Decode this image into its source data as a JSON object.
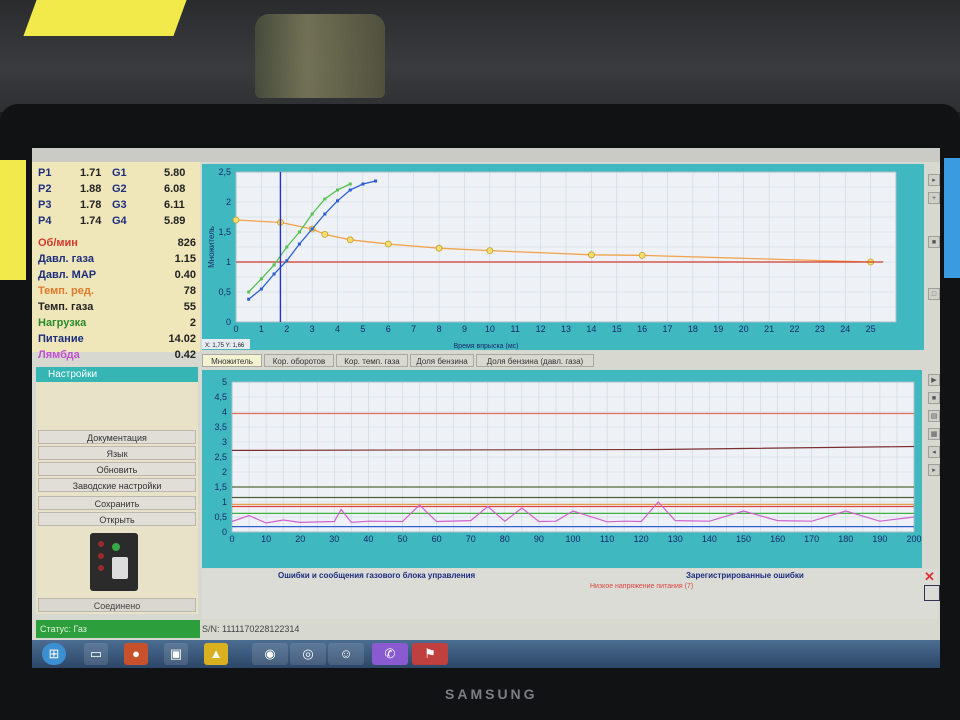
{
  "readouts": {
    "injectors": [
      {
        "p": "P1",
        "pv": "1.71",
        "g": "G1",
        "gv": "5.80"
      },
      {
        "p": "P2",
        "pv": "1.88",
        "g": "G2",
        "gv": "6.08"
      },
      {
        "p": "P3",
        "pv": "1.78",
        "g": "G3",
        "gv": "6.11"
      },
      {
        "p": "P4",
        "pv": "1.74",
        "g": "G4",
        "gv": "5.89"
      }
    ],
    "params": [
      {
        "label": "Об/мин",
        "value": "826",
        "color": "#d33a2c"
      },
      {
        "label": "Давл. газа",
        "value": "1.15",
        "color": "#1d2e7e"
      },
      {
        "label": "Давл. MAP",
        "value": "0.40",
        "color": "#1d2e7e"
      },
      {
        "label": "Темп. ред.",
        "value": "78",
        "color": "#e07a2a"
      },
      {
        "label": "Темп. газа",
        "value": "55",
        "color": "#222222"
      },
      {
        "label": "Нагрузка",
        "value": "2",
        "color": "#2b8a2b"
      },
      {
        "label": "Питание",
        "value": "14.02",
        "color": "#1d2e7e"
      },
      {
        "label": "Лямбда",
        "value": "0.42",
        "color": "#c24fd0"
      }
    ]
  },
  "settings": {
    "header": "Настройки",
    "buttons": [
      {
        "name": "documentation-button",
        "label": "Документация"
      },
      {
        "name": "language-select",
        "label": "Язык"
      },
      {
        "name": "update-button",
        "label": "Обновить"
      },
      {
        "name": "factory-settings-button",
        "label": "Заводские настройки"
      },
      {
        "name": "save-button",
        "label": "Сохранить"
      },
      {
        "name": "open-button",
        "label": "Открыть"
      }
    ],
    "connection": "Соединено"
  },
  "status": {
    "text": "Статус: Газ",
    "serial": "S/N: 1111170228122314"
  },
  "tabs": [
    "Множитель",
    "Кор. оборотов",
    "Кор. темп. газа",
    "Доля бензина",
    "Доля бензина (давл. газа)"
  ],
  "errors": {
    "title_left": "Ошибки и сообщения газового блока управления",
    "title_right": "Зарегистрированные ошибки",
    "message": "Низкое напряжение питания (7)"
  },
  "colors": {
    "accent": "#3fb8c0",
    "plot_bg": "#eef2f6",
    "status_green": "#2d9e3c"
  },
  "chart_data": [
    {
      "type": "line",
      "xlabel": "Время впрыска (мс)",
      "ylabel": "Множитель",
      "xlim": [
        0,
        26
      ],
      "ylim": [
        0,
        2.5
      ],
      "xticks": [
        "0",
        "1",
        "2",
        "3",
        "4",
        "5",
        "6",
        "7",
        "8",
        "9",
        "10",
        "11",
        "12",
        "13",
        "14",
        "15",
        "16",
        "17",
        "18",
        "19",
        "20",
        "21",
        "22",
        "23",
        "24",
        "25"
      ],
      "yticks": [
        "0",
        "0,5",
        "1",
        "1,5",
        "2",
        "2,5"
      ],
      "cursor_readout": "X: 1,75  Y: 1,66",
      "cursor_x": 1.75,
      "series": [
        {
          "color": "#f2a24a",
          "x": [
            0,
            1.75,
            3,
            3.5,
            4.5,
            6,
            8,
            10,
            14,
            16,
            25
          ],
          "y": [
            1.7,
            1.66,
            1.55,
            1.46,
            1.37,
            1.3,
            1.23,
            1.19,
            1.12,
            1.11,
            1.0
          ]
        },
        {
          "color": "#d23a2c",
          "x": [
            0,
            25.5
          ],
          "y": [
            1.0,
            1.0
          ]
        },
        {
          "color": "#2a5ed0",
          "x": [
            0.5,
            1,
            1.5,
            2,
            2.5,
            3,
            3.5,
            4,
            4.5,
            5,
            5.5
          ],
          "y": [
            0.38,
            0.55,
            0.8,
            1.02,
            1.3,
            1.55,
            1.8,
            2.02,
            2.2,
            2.3,
            2.35
          ]
        },
        {
          "color": "#56c050",
          "x": [
            0.5,
            1,
            1.5,
            2,
            2.5,
            3,
            3.5,
            4,
            4.5
          ],
          "y": [
            0.5,
            0.72,
            0.95,
            1.25,
            1.5,
            1.8,
            2.05,
            2.2,
            2.3
          ]
        }
      ]
    },
    {
      "type": "line",
      "xlim": [
        0,
        200
      ],
      "ylim": [
        0,
        5
      ],
      "xticks": [
        "0",
        "10",
        "20",
        "30",
        "40",
        "50",
        "60",
        "70",
        "80",
        "90",
        "100",
        "110",
        "120",
        "130",
        "140",
        "150",
        "160",
        "170",
        "180",
        "190",
        "200"
      ],
      "yticks": [
        "0",
        "0,5",
        "1",
        "1,5",
        "2",
        "2,5",
        "3",
        "3,5",
        "4",
        "4,5",
        "5"
      ],
      "series": [
        {
          "color": "#e0705a",
          "x": [
            0,
            200
          ],
          "y": [
            3.95,
            3.95
          ]
        },
        {
          "color": "#7a3030",
          "x": [
            0,
            125,
            200
          ],
          "y": [
            2.72,
            2.75,
            2.85
          ]
        },
        {
          "color": "#55693a",
          "x": [
            0,
            200
          ],
          "y": [
            1.5,
            1.5
          ]
        },
        {
          "color": "#4a5f3a",
          "x": [
            0,
            200
          ],
          "y": [
            1.15,
            1.15
          ]
        },
        {
          "color": "#e0a04a",
          "x": [
            0,
            200
          ],
          "y": [
            0.92,
            0.92
          ]
        },
        {
          "color": "#e04040",
          "x": [
            0,
            200
          ],
          "y": [
            0.85,
            0.85
          ]
        },
        {
          "color": "#40b040",
          "x": [
            0,
            200
          ],
          "y": [
            0.62,
            0.62
          ]
        },
        {
          "color": "#d060d0",
          "x": [
            0,
            5,
            10,
            15,
            20,
            30,
            32,
            35,
            40,
            50,
            55,
            60,
            70,
            75,
            80,
            85,
            90,
            95,
            100,
            110,
            115,
            120,
            125,
            130,
            140,
            150,
            160,
            170,
            180,
            190,
            200
          ],
          "y": [
            0.35,
            0.55,
            0.3,
            0.4,
            0.32,
            0.35,
            0.75,
            0.32,
            0.36,
            0.35,
            0.9,
            0.35,
            0.38,
            0.85,
            0.36,
            0.8,
            0.35,
            0.36,
            0.7,
            0.34,
            0.36,
            0.35,
            1.0,
            0.38,
            0.36,
            0.7,
            0.38,
            0.36,
            0.7,
            0.36,
            0.5
          ]
        },
        {
          "color": "#3060d0",
          "x": [
            0,
            200
          ],
          "y": [
            0.18,
            0.18
          ]
        }
      ]
    }
  ]
}
